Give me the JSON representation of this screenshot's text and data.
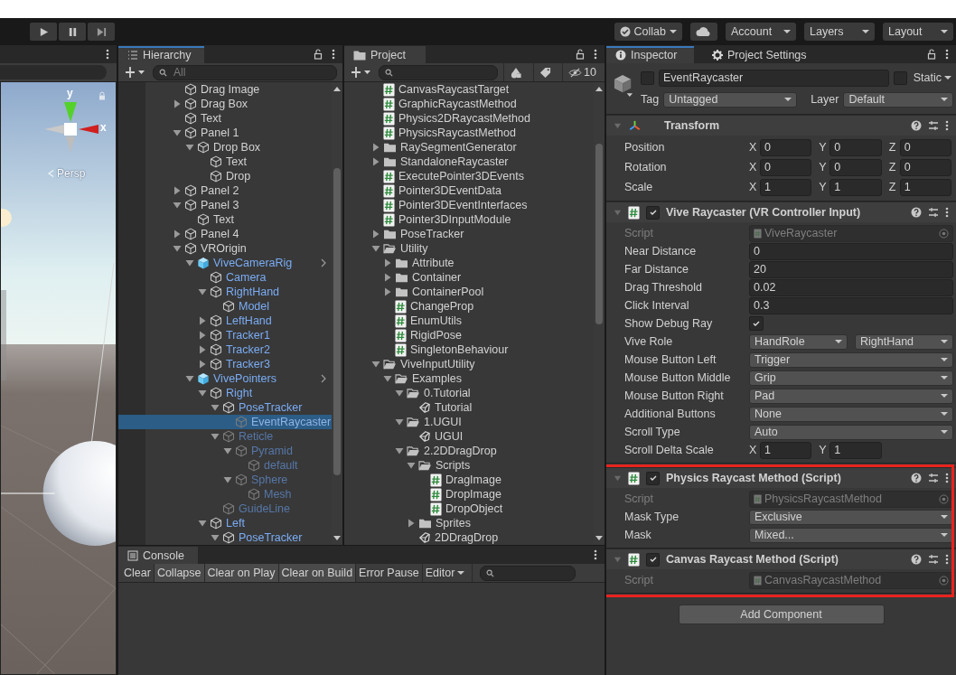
{
  "toolbar": {
    "collab": "Collab",
    "account": "Account",
    "layers": "Layers",
    "layout": "Layout"
  },
  "scene": {
    "gizmo_labels": [
      "y",
      "x"
    ],
    "view_label": "Persp"
  },
  "hierarchy": {
    "tab": "Hierarchy",
    "search": {
      "placeholder": "All"
    },
    "items": [
      {
        "name": "Drag Image",
        "kind": "object",
        "prefab": false,
        "inactive": false,
        "selected": false
      },
      {
        "name": "Drag Box",
        "kind": "object",
        "prefab": false,
        "inactive": false,
        "expanded": false,
        "selected": false
      },
      {
        "name": "Text",
        "kind": "object",
        "prefab": false,
        "inactive": false,
        "selected": false
      },
      {
        "name": "Panel 1",
        "kind": "object",
        "prefab": false,
        "inactive": false,
        "expanded": true,
        "selected": false,
        "children": [
          {
            "name": "Drop Box",
            "kind": "object",
            "prefab": false,
            "inactive": false,
            "expanded": true,
            "selected": false,
            "children": [
              {
                "name": "Text",
                "kind": "object",
                "prefab": false,
                "inactive": false,
                "selected": false
              },
              {
                "name": "Drop",
                "kind": "object",
                "prefab": false,
                "inactive": false,
                "selected": false
              }
            ]
          }
        ]
      },
      {
        "name": "Panel 2",
        "kind": "object",
        "prefab": false,
        "inactive": false,
        "expanded": false,
        "selected": false
      },
      {
        "name": "Panel 3",
        "kind": "object",
        "prefab": false,
        "inactive": false,
        "expanded": true,
        "selected": false,
        "children": [
          {
            "name": "Text",
            "kind": "object",
            "prefab": false,
            "inactive": false,
            "selected": false
          }
        ]
      },
      {
        "name": "Panel 4",
        "kind": "object",
        "prefab": false,
        "inactive": false,
        "expanded": false,
        "selected": false
      },
      {
        "name": "VROrigin",
        "kind": "object",
        "prefab": false,
        "inactive": false,
        "expanded": true,
        "selected": false,
        "children": [
          {
            "name": "ViveCameraRig",
            "kind": "prefab-root",
            "prefab": true,
            "inactive": false,
            "expanded": true,
            "selected": false,
            "children": [
              {
                "name": "Camera",
                "kind": "object",
                "prefab": true,
                "inactive": false,
                "selected": false
              },
              {
                "name": "RightHand",
                "kind": "object",
                "prefab": true,
                "inactive": false,
                "expanded": true,
                "selected": false,
                "children": [
                  {
                    "name": "Model",
                    "kind": "object",
                    "prefab": true,
                    "inactive": false,
                    "selected": false
                  }
                ]
              },
              {
                "name": "LeftHand",
                "kind": "object",
                "prefab": true,
                "inactive": false,
                "expanded": false,
                "selected": false
              },
              {
                "name": "Tracker1",
                "kind": "object",
                "prefab": true,
                "inactive": false,
                "expanded": false,
                "selected": false
              },
              {
                "name": "Tracker2",
                "kind": "object",
                "prefab": true,
                "inactive": false,
                "expanded": false,
                "selected": false
              },
              {
                "name": "Tracker3",
                "kind": "object",
                "prefab": true,
                "inactive": false,
                "expanded": false,
                "selected": false
              }
            ]
          },
          {
            "name": "VivePointers",
            "kind": "prefab-root",
            "prefab": true,
            "inactive": false,
            "expanded": true,
            "selected": false,
            "children": [
              {
                "name": "Right",
                "kind": "object",
                "prefab": true,
                "inactive": false,
                "expanded": true,
                "selected": false,
                "children": [
                  {
                    "name": "PoseTracker",
                    "kind": "object",
                    "prefab": true,
                    "inactive": false,
                    "expanded": true,
                    "selected": false,
                    "children": [
                      {
                        "name": "EventRaycaster",
                        "kind": "object",
                        "prefab": true,
                        "inactive": true,
                        "selected": true
                      }
                    ]
                  },
                  {
                    "name": "Reticle",
                    "kind": "object",
                    "prefab": true,
                    "inactive": true,
                    "expanded": true,
                    "selected": false,
                    "children": [
                      {
                        "name": "Pyramid",
                        "kind": "object",
                        "prefab": true,
                        "inactive": true,
                        "expanded": true,
                        "selected": false,
                        "children": [
                          {
                            "name": "default",
                            "kind": "object",
                            "prefab": true,
                            "inactive": true,
                            "selected": false
                          }
                        ]
                      },
                      {
                        "name": "Sphere",
                        "kind": "object",
                        "prefab": true,
                        "inactive": true,
                        "expanded": true,
                        "selected": false,
                        "children": [
                          {
                            "name": "Mesh",
                            "kind": "object",
                            "prefab": true,
                            "inactive": true,
                            "selected": false
                          }
                        ]
                      }
                    ]
                  },
                  {
                    "name": "GuideLine",
                    "kind": "object",
                    "prefab": true,
                    "inactive": true,
                    "selected": false
                  }
                ]
              },
              {
                "name": "Left",
                "kind": "object",
                "prefab": true,
                "inactive": false,
                "expanded": true,
                "selected": false,
                "children": [
                  {
                    "name": "PoseTracker",
                    "kind": "object",
                    "prefab": true,
                    "inactive": false,
                    "expanded": true,
                    "selected": false
                  }
                ]
              }
            ]
          }
        ]
      }
    ]
  },
  "project": {
    "tab": "Project",
    "hidden_count": "10",
    "items": [
      {
        "name": "CanvasRaycastTarget",
        "kind": "script"
      },
      {
        "name": "GraphicRaycastMethod",
        "kind": "script"
      },
      {
        "name": "Physics2DRaycastMethod",
        "kind": "script"
      },
      {
        "name": "PhysicsRaycastMethod",
        "kind": "script"
      },
      {
        "name": "RaySegmentGenerator",
        "kind": "folder",
        "expanded": false
      },
      {
        "name": "StandaloneRaycaster",
        "kind": "folder",
        "expanded": false
      },
      {
        "name": "ExecutePointer3DEvents",
        "kind": "script"
      },
      {
        "name": "Pointer3DEventData",
        "kind": "script"
      },
      {
        "name": "Pointer3DEventInterfaces",
        "kind": "script"
      },
      {
        "name": "Pointer3DInputModule",
        "kind": "script"
      },
      {
        "name": "PoseTracker",
        "kind": "folder",
        "expanded": false
      },
      {
        "name": "Utility",
        "kind": "folder",
        "expanded": true,
        "children": [
          {
            "name": "Attribute",
            "kind": "folder",
            "expanded": false
          },
          {
            "name": "Container",
            "kind": "folder",
            "expanded": false
          },
          {
            "name": "ContainerPool",
            "kind": "folder",
            "expanded": false
          },
          {
            "name": "ChangeProp",
            "kind": "script"
          },
          {
            "name": "EnumUtils",
            "kind": "script"
          },
          {
            "name": "RigidPose",
            "kind": "script"
          },
          {
            "name": "SingletonBehaviour",
            "kind": "script"
          }
        ]
      },
      {
        "name": "ViveInputUtility",
        "kind": "folder",
        "expanded": true,
        "children": [
          {
            "name": "Examples",
            "kind": "folder",
            "expanded": true,
            "children": [
              {
                "name": "0.Tutorial",
                "kind": "folder",
                "expanded": true,
                "children": [
                  {
                    "name": "Tutorial",
                    "kind": "scene"
                  }
                ]
              },
              {
                "name": "1.UGUI",
                "kind": "folder",
                "expanded": true,
                "children": [
                  {
                    "name": "UGUI",
                    "kind": "scene"
                  }
                ]
              },
              {
                "name": "2.2DDragDrop",
                "kind": "folder",
                "expanded": true,
                "children": [
                  {
                    "name": "Scripts",
                    "kind": "folder",
                    "expanded": true,
                    "children": [
                      {
                        "name": "DragImage",
                        "kind": "script"
                      },
                      {
                        "name": "DropImage",
                        "kind": "script"
                      },
                      {
                        "name": "DropObject",
                        "kind": "script"
                      }
                    ]
                  },
                  {
                    "name": "Sprites",
                    "kind": "folder",
                    "expanded": false
                  },
                  {
                    "name": "2DDragDrop",
                    "kind": "scene"
                  }
                ]
              }
            ]
          }
        ]
      }
    ]
  },
  "console": {
    "tab": "Console",
    "buttons": [
      {
        "label": "Clear",
        "on": false
      },
      {
        "label": "Collapse",
        "on": true
      },
      {
        "label": "Clear on Play",
        "on": true
      },
      {
        "label": "Clear on Build",
        "on": true
      },
      {
        "label": "Error Pause",
        "on": false
      }
    ],
    "dropdown": "Editor"
  },
  "inspector": {
    "tabs": [
      {
        "label": "Inspector",
        "selected": true
      },
      {
        "label": "Project Settings",
        "selected": false
      }
    ],
    "object": {
      "active": false,
      "name": "EventRaycaster",
      "static": false,
      "static_label": "Static",
      "tag_label": "Tag",
      "tag": "Untagged",
      "layer_label": "Layer",
      "layer": "Default"
    },
    "components": [
      {
        "kind": "transform",
        "title": "Transform",
        "highlighted": false,
        "fields": [
          {
            "kind": "vector",
            "label": "Position",
            "values": [
              {
                "axis": "X",
                "value": "0"
              },
              {
                "axis": "Y",
                "value": "0"
              },
              {
                "axis": "Z",
                "value": "0"
              }
            ]
          },
          {
            "kind": "vector",
            "label": "Rotation",
            "values": [
              {
                "axis": "X",
                "value": "0"
              },
              {
                "axis": "Y",
                "value": "0"
              },
              {
                "axis": "Z",
                "value": "0"
              }
            ]
          },
          {
            "kind": "vector",
            "label": "Scale",
            "values": [
              {
                "axis": "X",
                "value": "1"
              },
              {
                "axis": "Y",
                "value": "1"
              },
              {
                "axis": "Z",
                "value": "1"
              }
            ]
          }
        ]
      },
      {
        "kind": "script",
        "title": "Vive Raycaster (VR Controller Input)",
        "enabled": true,
        "highlighted": false,
        "fields": [
          {
            "kind": "object",
            "label": "Script",
            "value": "ViveRaycaster"
          },
          {
            "kind": "text",
            "label": "Near Distance",
            "value": "0"
          },
          {
            "kind": "text",
            "label": "Far Distance",
            "value": "20"
          },
          {
            "kind": "text",
            "label": "Drag Threshold",
            "value": "0.02"
          },
          {
            "kind": "text",
            "label": "Click Interval",
            "value": "0.3"
          },
          {
            "kind": "checkbox",
            "label": "Show Debug Ray",
            "checked": true
          },
          {
            "kind": "dropdown",
            "label": "Vive Role",
            "values": [
              "HandRole",
              "RightHand"
            ]
          },
          {
            "kind": "dropdown",
            "label": "Mouse Button Left",
            "values": [
              "Trigger"
            ]
          },
          {
            "kind": "dropdown",
            "label": "Mouse Button Middle",
            "values": [
              "Grip"
            ]
          },
          {
            "kind": "dropdown",
            "label": "Mouse Button Right",
            "values": [
              "Pad"
            ]
          },
          {
            "kind": "dropdown",
            "label": "Additional Buttons",
            "values": [
              "None"
            ]
          },
          {
            "kind": "dropdown",
            "label": "Scroll Type",
            "values": [
              "Auto"
            ]
          },
          {
            "kind": "vector",
            "label": "Scroll Delta Scale",
            "values": [
              {
                "axis": "X",
                "value": "1"
              },
              {
                "axis": "Y",
                "value": "1"
              }
            ]
          }
        ]
      },
      {
        "kind": "script",
        "title": "Physics Raycast Method (Script)",
        "enabled": true,
        "highlighted": true,
        "fields": [
          {
            "kind": "object",
            "label": "Script",
            "value": "PhysicsRaycastMethod"
          },
          {
            "kind": "dropdown",
            "label": "Mask Type",
            "values": [
              "Exclusive"
            ]
          },
          {
            "kind": "dropdown",
            "label": "Mask",
            "values": [
              "Mixed..."
            ]
          }
        ]
      },
      {
        "kind": "script",
        "title": "Canvas Raycast Method (Script)",
        "enabled": true,
        "highlighted": true,
        "fields": [
          {
            "kind": "object",
            "label": "Script",
            "value": "CanvasRaycastMethod"
          }
        ]
      }
    ],
    "add_button": "Add Component"
  }
}
